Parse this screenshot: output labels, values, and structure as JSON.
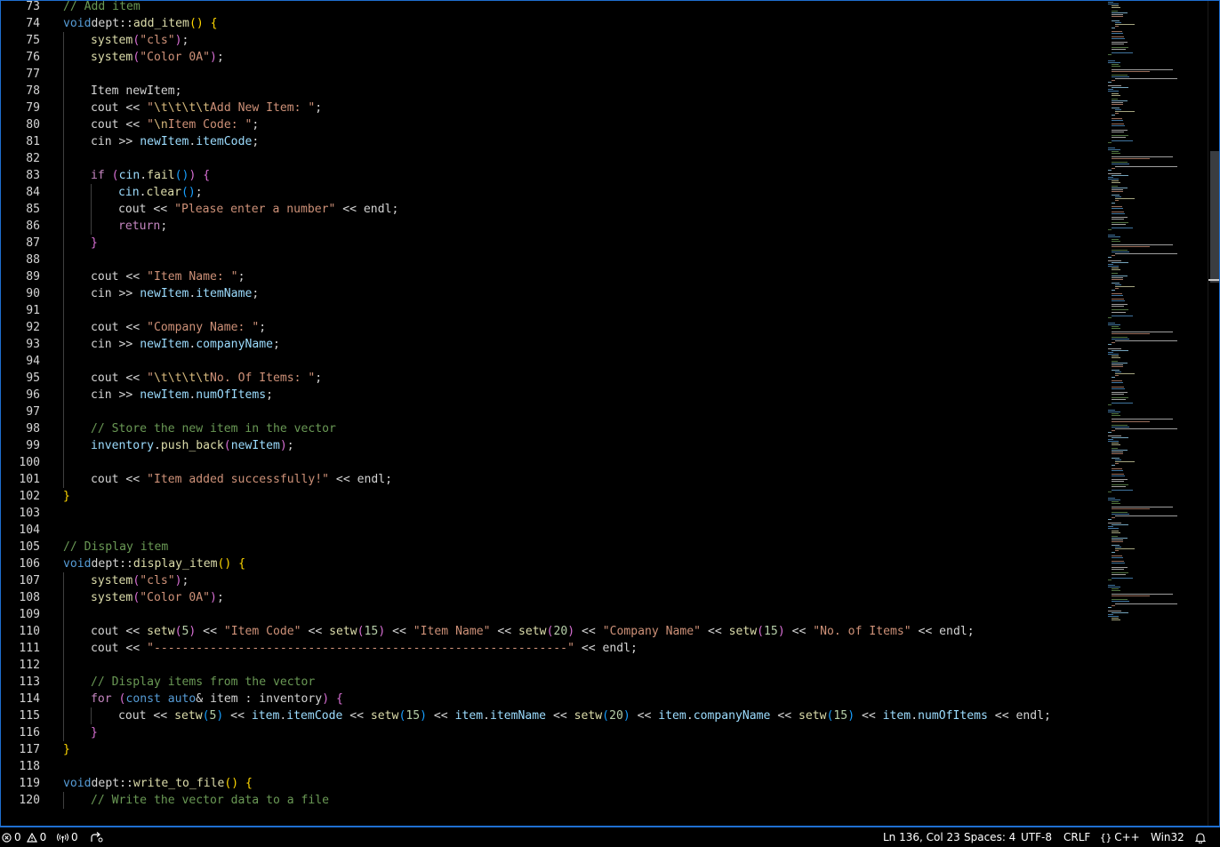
{
  "theme": {
    "background": "#000000",
    "accent_border": "#1f6fd0",
    "comment": "#6a9955",
    "keyword": "#569cd6",
    "control": "#c586c0",
    "function": "#dcdcaa",
    "string": "#ce9178",
    "variable": "#9cdcfe",
    "number": "#b5cea8"
  },
  "editor": {
    "lines": [
      {
        "n": "73",
        "indent": 0,
        "t": [
          [
            "cm",
            "// Add item"
          ]
        ]
      },
      {
        "n": "74",
        "indent": 0,
        "t": [
          [
            "kw",
            "void"
          ],
          [
            "",
            "dept"
          ],
          [
            "",
            "::"
          ],
          [
            "fn",
            "add_item"
          ],
          [
            "p1",
            "()"
          ],
          [
            "",
            " "
          ],
          [
            "p1",
            "{"
          ]
        ]
      },
      {
        "n": "75",
        "indent": 1,
        "t": [
          [
            "fn",
            "system"
          ],
          [
            "p2",
            "("
          ],
          [
            "str",
            "\"cls\""
          ],
          [
            "p2",
            ")"
          ],
          [
            "",
            ";"
          ]
        ]
      },
      {
        "n": "76",
        "indent": 1,
        "t": [
          [
            "fn",
            "system"
          ],
          [
            "p2",
            "("
          ],
          [
            "str",
            "\"Color 0A\""
          ],
          [
            "p2",
            ")"
          ],
          [
            "",
            ";"
          ]
        ]
      },
      {
        "n": "77",
        "indent": 1,
        "t": []
      },
      {
        "n": "78",
        "indent": 1,
        "t": [
          [
            "",
            "Item newItem;"
          ]
        ]
      },
      {
        "n": "79",
        "indent": 1,
        "t": [
          [
            "",
            "cout << "
          ],
          [
            "str",
            "\""
          ],
          [
            "esc",
            "\\t\\t\\t\\t"
          ],
          [
            "str",
            "Add New Item: \""
          ],
          [
            "",
            ";"
          ]
        ]
      },
      {
        "n": "80",
        "indent": 1,
        "t": [
          [
            "",
            "cout << "
          ],
          [
            "str",
            "\""
          ],
          [
            "esc",
            "\\n"
          ],
          [
            "str",
            "Item Code: \""
          ],
          [
            "",
            ";"
          ]
        ]
      },
      {
        "n": "81",
        "indent": 1,
        "t": [
          [
            "",
            "cin >> "
          ],
          [
            "var",
            "newItem"
          ],
          [
            "",
            "."
          ],
          [
            "var",
            "itemCode"
          ],
          [
            "",
            ";"
          ]
        ]
      },
      {
        "n": "82",
        "indent": 1,
        "t": []
      },
      {
        "n": "83",
        "indent": 1,
        "t": [
          [
            "cf",
            "if"
          ],
          [
            "",
            " "
          ],
          [
            "p2",
            "("
          ],
          [
            "var",
            "cin"
          ],
          [
            "",
            "."
          ],
          [
            "fn",
            "fail"
          ],
          [
            "p3",
            "()"
          ],
          [
            "p2",
            ")"
          ],
          [
            "",
            " "
          ],
          [
            "p2",
            "{"
          ]
        ]
      },
      {
        "n": "84",
        "indent": 2,
        "t": [
          [
            "var",
            "cin"
          ],
          [
            "",
            "."
          ],
          [
            "fn",
            "clear"
          ],
          [
            "p3",
            "()"
          ],
          [
            "",
            ";"
          ]
        ]
      },
      {
        "n": "85",
        "indent": 2,
        "t": [
          [
            "",
            "cout << "
          ],
          [
            "str",
            "\"Please enter a number\""
          ],
          [
            "",
            " << endl;"
          ]
        ]
      },
      {
        "n": "86",
        "indent": 2,
        "t": [
          [
            "cf",
            "return"
          ],
          [
            "",
            ";"
          ]
        ]
      },
      {
        "n": "87",
        "indent": 1,
        "t": [
          [
            "p2",
            "}"
          ]
        ]
      },
      {
        "n": "88",
        "indent": 1,
        "t": []
      },
      {
        "n": "89",
        "indent": 1,
        "t": [
          [
            "",
            "cout << "
          ],
          [
            "str",
            "\"Item Name: \""
          ],
          [
            "",
            ";"
          ]
        ]
      },
      {
        "n": "90",
        "indent": 1,
        "t": [
          [
            "",
            "cin >> "
          ],
          [
            "var",
            "newItem"
          ],
          [
            "",
            "."
          ],
          [
            "var",
            "itemName"
          ],
          [
            "",
            ";"
          ]
        ]
      },
      {
        "n": "91",
        "indent": 1,
        "t": []
      },
      {
        "n": "92",
        "indent": 1,
        "t": [
          [
            "",
            "cout << "
          ],
          [
            "str",
            "\"Company Name: \""
          ],
          [
            "",
            ";"
          ]
        ]
      },
      {
        "n": "93",
        "indent": 1,
        "t": [
          [
            "",
            "cin >> "
          ],
          [
            "var",
            "newItem"
          ],
          [
            "",
            "."
          ],
          [
            "var",
            "companyName"
          ],
          [
            "",
            ";"
          ]
        ]
      },
      {
        "n": "94",
        "indent": 1,
        "t": []
      },
      {
        "n": "95",
        "indent": 1,
        "t": [
          [
            "",
            "cout << "
          ],
          [
            "str",
            "\""
          ],
          [
            "esc",
            "\\t\\t\\t\\t"
          ],
          [
            "str",
            "No. Of Items: \""
          ],
          [
            "",
            ";"
          ]
        ]
      },
      {
        "n": "96",
        "indent": 1,
        "t": [
          [
            "",
            "cin >> "
          ],
          [
            "var",
            "newItem"
          ],
          [
            "",
            "."
          ],
          [
            "var",
            "numOfItems"
          ],
          [
            "",
            ";"
          ]
        ]
      },
      {
        "n": "97",
        "indent": 1,
        "t": []
      },
      {
        "n": "98",
        "indent": 1,
        "t": [
          [
            "cm",
            "// Store the new item in the vector"
          ]
        ]
      },
      {
        "n": "99",
        "indent": 1,
        "t": [
          [
            "var",
            "inventory"
          ],
          [
            "",
            "."
          ],
          [
            "fn",
            "push_back"
          ],
          [
            "p2",
            "("
          ],
          [
            "var",
            "newItem"
          ],
          [
            "p2",
            ")"
          ],
          [
            "",
            ";"
          ]
        ]
      },
      {
        "n": "100",
        "indent": 1,
        "t": []
      },
      {
        "n": "101",
        "indent": 1,
        "t": [
          [
            "",
            "cout << "
          ],
          [
            "str",
            "\"Item added successfully!\""
          ],
          [
            "",
            " << endl;"
          ]
        ]
      },
      {
        "n": "102",
        "indent": 0,
        "t": [
          [
            "p1",
            "}"
          ]
        ]
      },
      {
        "n": "103",
        "indent": 0,
        "t": []
      },
      {
        "n": "104",
        "indent": 0,
        "t": []
      },
      {
        "n": "105",
        "indent": 0,
        "t": [
          [
            "cm",
            "// Display item"
          ]
        ]
      },
      {
        "n": "106",
        "indent": 0,
        "t": [
          [
            "kw",
            "void"
          ],
          [
            "",
            "dept"
          ],
          [
            "",
            "::"
          ],
          [
            "fn",
            "display_item"
          ],
          [
            "p1",
            "()"
          ],
          [
            "",
            " "
          ],
          [
            "p1",
            "{"
          ]
        ]
      },
      {
        "n": "107",
        "indent": 1,
        "t": [
          [
            "fn",
            "system"
          ],
          [
            "p2",
            "("
          ],
          [
            "str",
            "\"cls\""
          ],
          [
            "p2",
            ")"
          ],
          [
            "",
            ";"
          ]
        ]
      },
      {
        "n": "108",
        "indent": 1,
        "t": [
          [
            "fn",
            "system"
          ],
          [
            "p2",
            "("
          ],
          [
            "str",
            "\"Color 0A\""
          ],
          [
            "p2",
            ")"
          ],
          [
            "",
            ";"
          ]
        ]
      },
      {
        "n": "109",
        "indent": 1,
        "t": []
      },
      {
        "n": "110",
        "indent": 1,
        "t": [
          [
            "",
            "cout << "
          ],
          [
            "fn",
            "setw"
          ],
          [
            "p2",
            "("
          ],
          [
            "num",
            "5"
          ],
          [
            "p2",
            ")"
          ],
          [
            "",
            " << "
          ],
          [
            "str",
            "\"Item Code\""
          ],
          [
            "",
            " << "
          ],
          [
            "fn",
            "setw"
          ],
          [
            "p2",
            "("
          ],
          [
            "num",
            "15"
          ],
          [
            "p2",
            ")"
          ],
          [
            "",
            " << "
          ],
          [
            "str",
            "\"Item Name\""
          ],
          [
            "",
            " << "
          ],
          [
            "fn",
            "setw"
          ],
          [
            "p2",
            "("
          ],
          [
            "num",
            "20"
          ],
          [
            "p2",
            ")"
          ],
          [
            "",
            " << "
          ],
          [
            "str",
            "\"Company Name\""
          ],
          [
            "",
            " << "
          ],
          [
            "fn",
            "setw"
          ],
          [
            "p2",
            "("
          ],
          [
            "num",
            "15"
          ],
          [
            "p2",
            ")"
          ],
          [
            "",
            " << "
          ],
          [
            "str",
            "\"No. of Items\""
          ],
          [
            "",
            " << endl;"
          ]
        ]
      },
      {
        "n": "111",
        "indent": 1,
        "t": [
          [
            "",
            "cout << "
          ],
          [
            "str",
            "\"-----------------------------------------------------------\""
          ],
          [
            "",
            " << endl;"
          ]
        ]
      },
      {
        "n": "112",
        "indent": 1,
        "t": []
      },
      {
        "n": "113",
        "indent": 1,
        "t": [
          [
            "cm",
            "// Display items from the vector"
          ]
        ]
      },
      {
        "n": "114",
        "indent": 1,
        "t": [
          [
            "cf",
            "for"
          ],
          [
            "",
            " "
          ],
          [
            "p2",
            "("
          ],
          [
            "kw",
            "const"
          ],
          [
            "",
            " "
          ],
          [
            "kw",
            "auto"
          ],
          [
            "",
            "& item : inventory"
          ],
          [
            "p2",
            ")"
          ],
          [
            "",
            " "
          ],
          [
            "p2",
            "{"
          ]
        ]
      },
      {
        "n": "115",
        "indent": 2,
        "t": [
          [
            "",
            "cout << "
          ],
          [
            "fn",
            "setw"
          ],
          [
            "p3",
            "("
          ],
          [
            "num",
            "5"
          ],
          [
            "p3",
            ")"
          ],
          [
            "",
            " << "
          ],
          [
            "var",
            "item"
          ],
          [
            "",
            "."
          ],
          [
            "var",
            "itemCode"
          ],
          [
            "",
            " << "
          ],
          [
            "fn",
            "setw"
          ],
          [
            "p3",
            "("
          ],
          [
            "num",
            "15"
          ],
          [
            "p3",
            ")"
          ],
          [
            "",
            " << "
          ],
          [
            "var",
            "item"
          ],
          [
            "",
            "."
          ],
          [
            "var",
            "itemName"
          ],
          [
            "",
            " << "
          ],
          [
            "fn",
            "setw"
          ],
          [
            "p3",
            "("
          ],
          [
            "num",
            "20"
          ],
          [
            "p3",
            ")"
          ],
          [
            "",
            " << "
          ],
          [
            "var",
            "item"
          ],
          [
            "",
            "."
          ],
          [
            "var",
            "companyName"
          ],
          [
            "",
            " << "
          ],
          [
            "fn",
            "setw"
          ],
          [
            "p3",
            "("
          ],
          [
            "num",
            "15"
          ],
          [
            "p3",
            ")"
          ],
          [
            "",
            " << "
          ],
          [
            "var",
            "item"
          ],
          [
            "",
            "."
          ],
          [
            "var",
            "numOfItems"
          ],
          [
            "",
            " << endl;"
          ]
        ]
      },
      {
        "n": "116",
        "indent": 1,
        "t": [
          [
            "p2",
            "}"
          ]
        ]
      },
      {
        "n": "117",
        "indent": 0,
        "t": [
          [
            "p1",
            "}"
          ]
        ]
      },
      {
        "n": "118",
        "indent": 0,
        "t": []
      },
      {
        "n": "119",
        "indent": 0,
        "t": [
          [
            "kw",
            "void"
          ],
          [
            "",
            "dept"
          ],
          [
            "",
            "::"
          ],
          [
            "fn",
            "write_to_file"
          ],
          [
            "p1",
            "()"
          ],
          [
            "",
            " "
          ],
          [
            "p1",
            "{"
          ]
        ]
      },
      {
        "n": "120",
        "indent": 1,
        "t": [
          [
            "cm",
            "// Write the vector data to a file"
          ]
        ]
      }
    ]
  },
  "statusbar": {
    "errors": "0",
    "warnings": "0",
    "ports": "0",
    "error_icon": "circle-x-icon",
    "warning_icon": "warning-icon",
    "ports_icon": "broadcast-icon",
    "remote_icon": "live-share-icon",
    "cursor_position": "Ln 136, Col 23",
    "indentation": "Spaces: 4",
    "encoding": "UTF-8",
    "line_ending": "CRLF",
    "language": "C++",
    "language_icon": "braces-icon",
    "configuration": "Win32",
    "notification_icon": "bell-icon"
  }
}
